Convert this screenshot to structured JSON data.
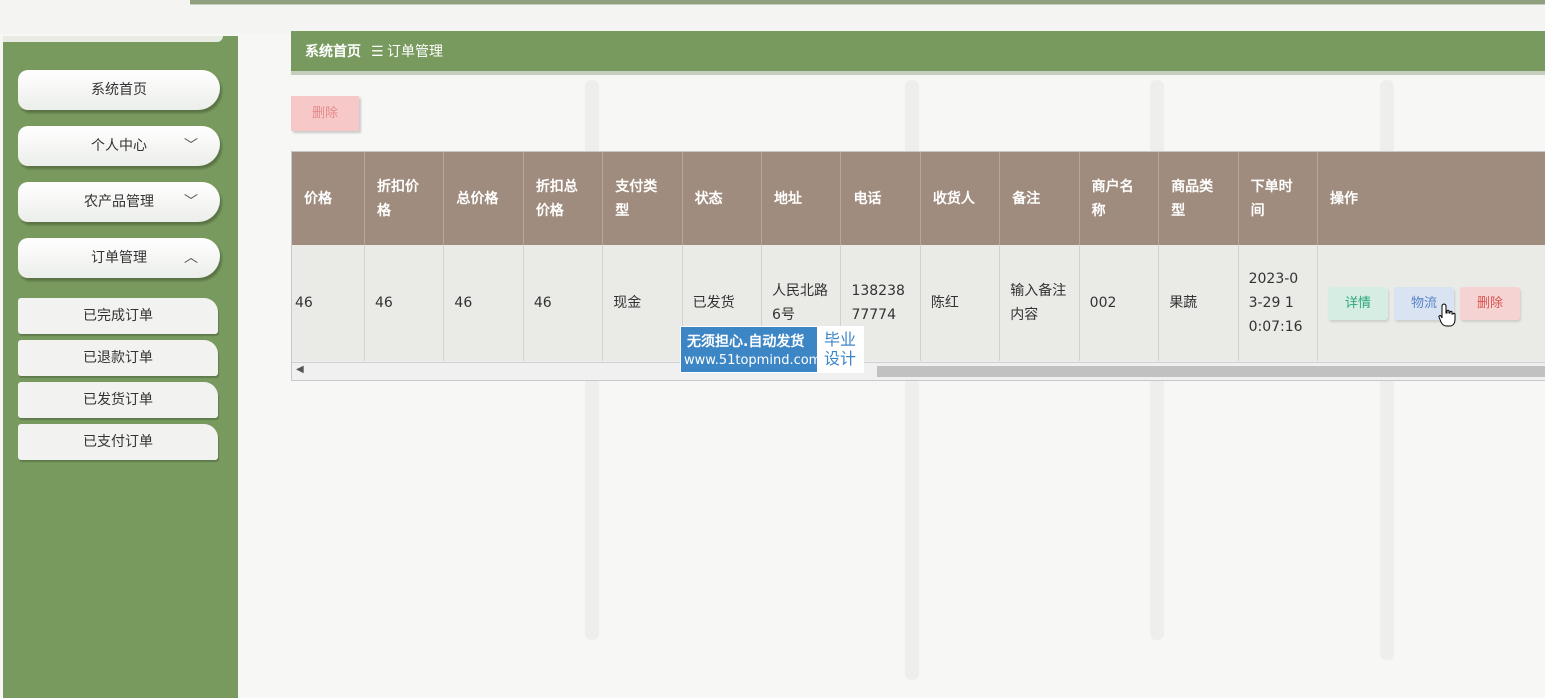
{
  "breadcrumb": {
    "home": "系统首页",
    "separator": "☰",
    "current": "订单管理"
  },
  "sidebar": {
    "items": [
      {
        "label": "系统首页"
      },
      {
        "label": "个人中心",
        "chevron": "﹀"
      },
      {
        "label": "农产品管理",
        "chevron": "﹀"
      },
      {
        "label": "订单管理",
        "chevron": "︿"
      }
    ],
    "subitems": [
      {
        "label": "已完成订单"
      },
      {
        "label": "已退款订单"
      },
      {
        "label": "已发货订单"
      },
      {
        "label": "已支付订单"
      }
    ]
  },
  "toolbar": {
    "delete_label": "删除"
  },
  "table": {
    "headers": [
      "价格",
      "折扣价格",
      "总价格",
      "折扣总价格",
      "支付类型",
      "状态",
      "地址",
      "电话",
      "收货人",
      "备注",
      "商户名称",
      "商品类型",
      "下单时间",
      "操作"
    ],
    "row": {
      "price": "46",
      "discount_price": "46",
      "total_price": "46",
      "discount_total_price": "46",
      "pay_type": "现金",
      "status": "已发货",
      "address": "人民北路6号",
      "phone": "13823877774",
      "receiver": "陈红",
      "remark": "输入备注内容",
      "merchant": "002",
      "category": "果蔬",
      "order_time": "2023-03-29 10:07:16"
    },
    "actions": {
      "detail": "详情",
      "logistics": "物流",
      "delete": "删除"
    }
  },
  "watermark": {
    "line1": "无须担心.自动发货",
    "line2": "www.51topmind.com",
    "box_line1": "毕业",
    "box_line2": "设计"
  },
  "colors": {
    "sidebar": "#789a5e",
    "header": "#9f8c7e",
    "accent_delete": "#f6c8c8"
  }
}
